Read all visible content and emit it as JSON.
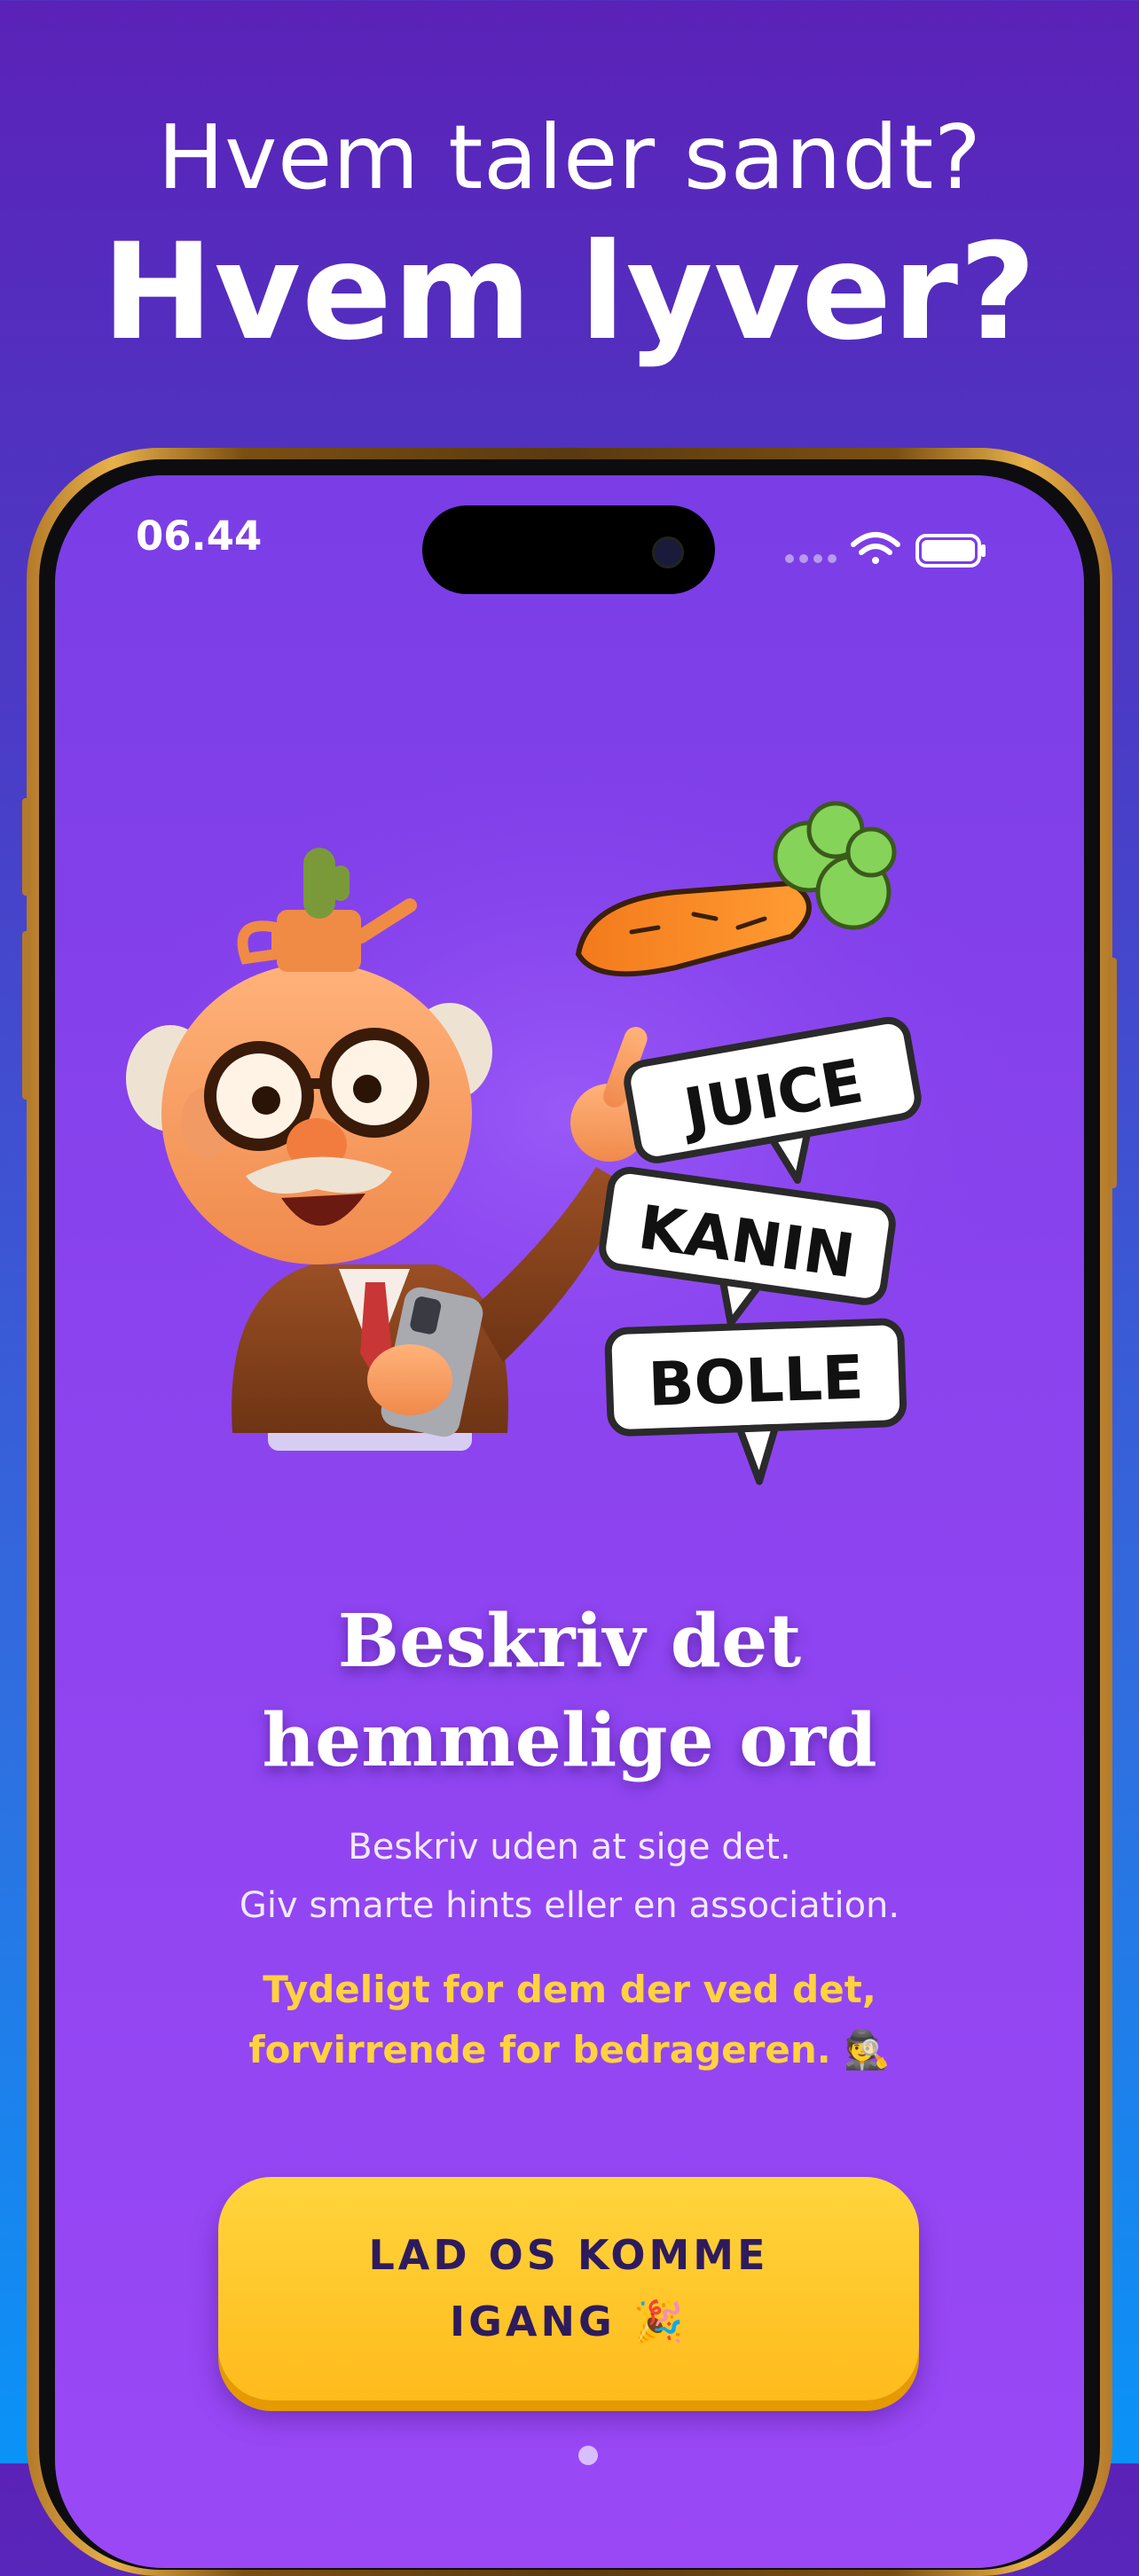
{
  "headline": {
    "line1": "Hvem taler sandt?",
    "line2": "Hvem lyver?"
  },
  "status_bar": {
    "time": "06.44",
    "icons": [
      "signal-dots-icon",
      "wifi-icon",
      "battery-icon"
    ]
  },
  "illustration": {
    "words": [
      "JUICE",
      "KANIN",
      "BOLLE"
    ],
    "elements": [
      "professor-character",
      "carrot-icon",
      "speech-bubbles"
    ]
  },
  "main": {
    "title_lines": [
      "Beskriv det",
      "hemmelige ord"
    ],
    "description_lines": [
      "Beskriv uden at sige det.",
      "Giv smarte hints eller en association."
    ],
    "highlight_lines": [
      "Tydeligt for dem der ved det,",
      "forvirrende for bedrageren. 🕵️"
    ]
  },
  "cta": {
    "label_lines": [
      "LAD OS KOMME",
      "IGANG 🎉"
    ]
  },
  "colors": {
    "background_top": "#5b22b8",
    "background_bottom": "#0a93f7",
    "screen": "#8a43ee",
    "highlight": "#ffd23e",
    "button": "#ffc62a",
    "button_text": "#2e1b5e"
  }
}
